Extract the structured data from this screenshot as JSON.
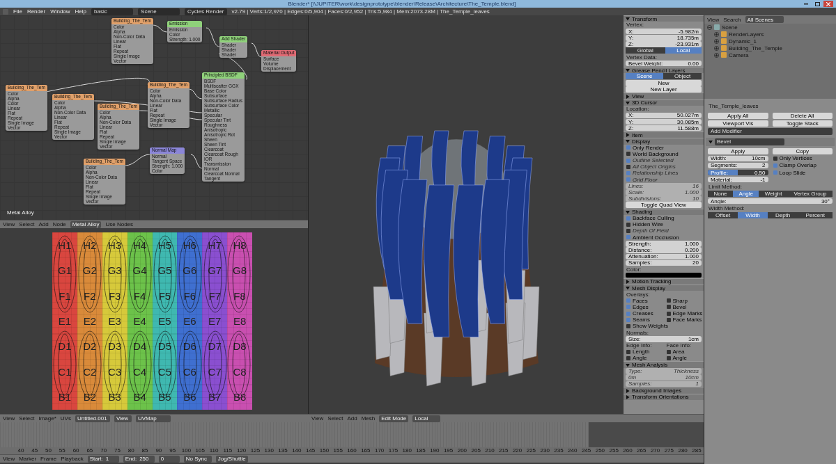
{
  "window": {
    "title": "Blender* [\\\\JUPITER\\work\\designprototype\\blender\\Release\\Architecture\\The_Temple.blend]"
  },
  "menu": {
    "items": [
      "File",
      "Render",
      "Window",
      "Help"
    ],
    "screen_layout": "basic",
    "scene": "Scene",
    "engine": "Cycles Render",
    "stats": "v2.79 | Verts:1/2,970 | Edges:0/5,904 | Faces:0/2,952 | Tris:5,984 | Mem:2073.28M | The_Temple_leaves"
  },
  "node_editor": {
    "material_label": "Metal Alloy",
    "nodes": [
      {
        "title": "Building_The_Tem",
        "kind": "image",
        "rows": [
          "Color",
          "Alpha",
          "Non-Color Data",
          "Linear",
          "Flat",
          "Repeat",
          "Single Image",
          "Vector"
        ]
      },
      {
        "title": "Emission",
        "kind": "shader",
        "rows": [
          "Emission",
          "Color",
          "Strength: 1.000"
        ]
      },
      {
        "title": "Add Shader",
        "kind": "shader",
        "rows": [
          "Shader",
          "Shader",
          "Shader"
        ]
      },
      {
        "title": "Material Output",
        "kind": "output",
        "rows": [
          "Surface",
          "Volume",
          "Displacement"
        ]
      },
      {
        "title": "Principled BSDF",
        "kind": "shader",
        "rows": [
          "BSDF",
          "Multiscatter GGX",
          "Base Color",
          "Subsurface",
          "Subsurface Radius",
          "Subsurface Color",
          "Metallic",
          "Specular",
          "Specular Tint",
          "Roughness",
          "Anisotropic",
          "Anisotropic Rot",
          "Sheen",
          "Sheen Tint",
          "Clearcoat",
          "Clearcoat Rough",
          "IOR",
          "Transmission",
          "Normal",
          "Clearcoat Normal",
          "Tangent"
        ]
      },
      {
        "title": "Building_The_Tem",
        "kind": "image",
        "rows": [
          "Color",
          "Alpha",
          "Color",
          "Linear",
          "Flat",
          "Repeat",
          "Single Image",
          "Vector"
        ]
      },
      {
        "title": "Building_The_Tem",
        "kind": "image",
        "rows": [
          "Color",
          "Alpha",
          "Non-Color Data",
          "Linear",
          "Flat",
          "Repeat",
          "Single Image",
          "Vector"
        ]
      },
      {
        "title": "Building_The_Tem",
        "kind": "image",
        "rows": [
          "Color",
          "Alpha",
          "Non-Color Data",
          "Linear",
          "Flat",
          "Repeat",
          "Single Image",
          "Vector"
        ]
      },
      {
        "title": "Building_The_Tem",
        "kind": "image",
        "rows": [
          "Color",
          "Alpha",
          "Non-Color Data",
          "Linear",
          "Flat",
          "Repeat",
          "Single Image",
          "Vector"
        ]
      },
      {
        "title": "Normal Map",
        "kind": "vector",
        "rows": [
          "Normal",
          "Tangent Space",
          "Strength: 1.000",
          "Color"
        ]
      },
      {
        "title": "Building_The_Tem",
        "kind": "image",
        "rows": [
          "Color",
          "Alpha",
          "Non-Color Data",
          "Linear",
          "Flat",
          "Repeat",
          "Single Image",
          "Vector"
        ]
      }
    ],
    "header": {
      "items": [
        "View",
        "Select",
        "Add",
        "Node"
      ],
      "material": "Metal Alloy",
      "use_nodes": "Use Nodes"
    }
  },
  "uv_editor": {
    "rows": [
      [
        "H1",
        "H2",
        "H3",
        "H4",
        "H5",
        "H6",
        "H7",
        "H8"
      ],
      [
        "G1",
        "G2",
        "G3",
        "G4",
        "G5",
        "G6",
        "G7",
        "G8"
      ],
      [
        "F1",
        "F2",
        "F3",
        "F4",
        "F5",
        "F6",
        "F7",
        "F8"
      ],
      [
        "E1",
        "E2",
        "E3",
        "E4",
        "E5",
        "E6",
        "E7",
        "E8"
      ],
      [
        "D1",
        "D2",
        "D3",
        "D4",
        "D5",
        "D6",
        "D7",
        "D8"
      ],
      [
        "C1",
        "C2",
        "C3",
        "C4",
        "C5",
        "C6",
        "C7",
        "C8"
      ],
      [
        "B1",
        "B2",
        "B3",
        "B4",
        "B5",
        "B6",
        "B7",
        "B8"
      ]
    ],
    "header": {
      "items": [
        "View",
        "Select",
        "Image*",
        "UVs"
      ],
      "image": "Untitled.001",
      "view": "View",
      "uv_map": "UVMap"
    }
  },
  "viewport_header": {
    "items": [
      "View",
      "Select",
      "Add",
      "Mesh"
    ],
    "mode": "Edit Mode",
    "orientation": "Local"
  },
  "n_panel": [
    {
      "kind": "header",
      "label": "Transform",
      "expanded": true
    },
    {
      "kind": "label",
      "label": "Vertex:"
    },
    {
      "kind": "field",
      "label": "X:",
      "value": "-5.982m"
    },
    {
      "kind": "field",
      "label": "Y:",
      "value": "18.735m"
    },
    {
      "kind": "field",
      "label": "Z:",
      "value": "-23.931m"
    },
    {
      "kind": "toggle",
      "options": [
        {
          "label": "Global",
          "selected": false
        },
        {
          "label": "Local",
          "selected": true
        }
      ]
    },
    {
      "kind": "label",
      "label": "Vertex Data:"
    },
    {
      "kind": "field",
      "label": "Bevel Weight:",
      "value": "0.00"
    },
    {
      "kind": "header",
      "label": "Grease Pencil Layers",
      "expanded": true
    },
    {
      "kind": "toggle",
      "options": [
        {
          "label": "Scene",
          "selected": true
        },
        {
          "label": "Object",
          "selected": false
        }
      ]
    },
    {
      "kind": "button",
      "label": "New"
    },
    {
      "kind": "button",
      "label": "New Layer"
    },
    {
      "kind": "header",
      "label": "View",
      "expanded": false
    },
    {
      "kind": "header",
      "label": "3D Cursor",
      "expanded": true
    },
    {
      "kind": "label",
      "label": "Location:"
    },
    {
      "kind": "field",
      "label": "X:",
      "value": "50.027m"
    },
    {
      "kind": "field",
      "label": "Y:",
      "value": "30.085m"
    },
    {
      "kind": "field",
      "label": "Z:",
      "value": "11.588m"
    },
    {
      "kind": "header",
      "label": "Item",
      "expanded": false
    },
    {
      "kind": "header",
      "label": "Display",
      "expanded": true
    },
    {
      "kind": "check",
      "label": "Only Render",
      "checked": true,
      "disabled": false
    },
    {
      "kind": "check",
      "label": "World Background",
      "checked": false,
      "disabled": false
    },
    {
      "kind": "check",
      "label": "Outline Selected",
      "checked": true,
      "disabled": true
    },
    {
      "kind": "check",
      "label": "All Object Origins",
      "checked": false,
      "disabled": true
    },
    {
      "kind": "check",
      "label": "Relationship Lines",
      "checked": true,
      "disabled": true
    },
    {
      "kind": "check",
      "label": "Grid Floor",
      "checked": true,
      "disabled": true
    },
    {
      "kind": "field",
      "label": "Lines:",
      "value": "16",
      "disabled": true
    },
    {
      "kind": "field",
      "label": "Scale:",
      "value": "1.000",
      "disabled": true
    },
    {
      "kind": "field",
      "label": "Subdivisions:",
      "value": "10",
      "disabled": true
    },
    {
      "kind": "button",
      "label": "Toggle Quad View"
    },
    {
      "kind": "header",
      "label": "Shading",
      "expanded": true
    },
    {
      "kind": "check",
      "label": "Backface Culling",
      "checked": true,
      "disabled": false
    },
    {
      "kind": "check",
      "label": "Hidden Wire",
      "checked": false,
      "disabled": false
    },
    {
      "kind": "check",
      "label": "Depth Of Field",
      "checked": false,
      "disabled": true
    },
    {
      "kind": "check",
      "label": "Ambient Occlusion",
      "checked": true,
      "disabled": false
    },
    {
      "kind": "field",
      "label": "Strength:",
      "value": "1.000"
    },
    {
      "kind": "field",
      "label": "Distance:",
      "value": "0.200"
    },
    {
      "kind": "field",
      "label": "Attenuation:",
      "value": "1.000"
    },
    {
      "kind": "field",
      "label": "Samples:",
      "value": "20"
    },
    {
      "kind": "label",
      "label": "Color:"
    },
    {
      "kind": "swatch"
    },
    {
      "kind": "header",
      "label": "Motion Tracking",
      "expanded": false
    },
    {
      "kind": "header",
      "label": "Mesh Display",
      "expanded": true
    },
    {
      "kind": "label",
      "label": "Overlays:"
    },
    {
      "kind": "checkpair",
      "items": [
        {
          "label": "Faces",
          "checked": true
        },
        {
          "label": "Sharp",
          "checked": false
        }
      ]
    },
    {
      "kind": "checkpair",
      "items": [
        {
          "label": "Edges",
          "checked": true
        },
        {
          "label": "Bevel",
          "checked": false
        }
      ]
    },
    {
      "kind": "checkpair",
      "items": [
        {
          "label": "Creases",
          "checked": true
        },
        {
          "label": "Edge Marks",
          "checked": false
        }
      ]
    },
    {
      "kind": "checkpair",
      "items": [
        {
          "label": "Seams",
          "checked": true
        },
        {
          "label": "Face Marks",
          "checked": false
        }
      ]
    },
    {
      "kind": "check",
      "label": "Show Weights",
      "checked": false,
      "disabled": false
    },
    {
      "kind": "label",
      "label": "Normals:"
    },
    {
      "kind": "field",
      "label": "Size:",
      "value": "1cm"
    },
    {
      "kind": "labelpair",
      "items": [
        "Edge Info:",
        "Face Info:"
      ]
    },
    {
      "kind": "checkpair",
      "items": [
        {
          "label": "Length",
          "checked": false
        },
        {
          "label": "Area",
          "checked": false
        }
      ]
    },
    {
      "kind": "checkpair",
      "items": [
        {
          "label": "Angle",
          "checked": false
        },
        {
          "label": "Angle",
          "checked": false
        }
      ]
    },
    {
      "kind": "header",
      "label": "Mesh Analysis",
      "expanded": true
    },
    {
      "kind": "field",
      "label": "Type:",
      "value": "Thickness",
      "disabled": true
    },
    {
      "kind": "field",
      "label": "0m",
      "value": "10cm",
      "disabled": true
    },
    {
      "kind": "field",
      "label": "Samples:",
      "value": "1",
      "disabled": true
    },
    {
      "kind": "header",
      "label": "Background Images",
      "expanded": false
    },
    {
      "kind": "header",
      "label": "Transform Orientations",
      "expanded": false
    }
  ],
  "outliner": {
    "view": "View",
    "search": "Search",
    "scenes": "All Scenes",
    "tree": [
      {
        "label": "Scene",
        "expanded": true,
        "children": [
          {
            "label": "RenderLayers",
            "expanded": false
          },
          {
            "label": "Dynamic_1",
            "expanded": false
          },
          {
            "label": "Building_The_Temple",
            "expanded": false
          },
          {
            "label": "Camera",
            "expanded": false
          }
        ]
      }
    ]
  },
  "properties": {
    "object": "The_Temple_leaves",
    "items": [
      {
        "kind": "buttonpair",
        "items": [
          "Apply All",
          "Delete All"
        ]
      },
      {
        "kind": "buttonpair",
        "items": [
          "Viewport Vis",
          "Toggle Stack"
        ]
      },
      {
        "kind": "dropdown",
        "label": "Add Modifier"
      },
      {
        "kind": "modifier",
        "label": "Bevel",
        "expanded": true
      },
      {
        "kind": "buttonpair",
        "items": [
          "Apply",
          "Copy"
        ]
      },
      {
        "kind": "fieldcheck",
        "label": "Width:",
        "value": "10cm",
        "check": {
          "label": "Only Vertices",
          "checked": false
        }
      },
      {
        "kind": "fieldcheck",
        "label": "Segments:",
        "value": "2",
        "check": {
          "label": "Clamp Overlap",
          "checked": true
        }
      },
      {
        "kind": "slidercheck",
        "label": "Profile:",
        "value": "0.50",
        "level": 0.5,
        "check": {
          "label": "Loop Slide",
          "checked": true
        }
      },
      {
        "kind": "fieldcheck",
        "label": "Material:",
        "value": "-1"
      },
      {
        "kind": "label",
        "label": "Limit Method:"
      },
      {
        "kind": "toggle",
        "options": [
          {
            "label": "None",
            "selected": false
          },
          {
            "label": "Angle",
            "selected": true
          },
          {
            "label": "Weight",
            "selected": false
          },
          {
            "label": "Vertex Group",
            "selected": false
          }
        ]
      },
      {
        "kind": "field",
        "label": "Angle:",
        "value": "30°"
      },
      {
        "kind": "label",
        "label": "Width Method:"
      },
      {
        "kind": "toggle",
        "options": [
          {
            "label": "Offset",
            "selected": false
          },
          {
            "label": "Width",
            "selected": true
          },
          {
            "label": "Depth",
            "selected": false
          },
          {
            "label": "Percent",
            "selected": false
          }
        ]
      }
    ]
  },
  "timeline": {
    "ticks": [
      "40",
      "45",
      "50",
      "55",
      "60",
      "65",
      "70",
      "75",
      "80",
      "85",
      "90",
      "95",
      "100",
      "105",
      "110",
      "115",
      "120",
      "125",
      "130",
      "135",
      "140",
      "145",
      "150",
      "155",
      "160",
      "165",
      "170",
      "175",
      "180",
      "185",
      "190",
      "195",
      "200",
      "205",
      "210",
      "215",
      "220",
      "225",
      "230",
      "235",
      "240",
      "245",
      "250",
      "255",
      "260",
      "265",
      "270",
      "275",
      "280",
      "285"
    ],
    "header": {
      "items": [
        "View",
        "Marker",
        "Frame",
        "Playback"
      ],
      "start": "Start:",
      "start_value": "1",
      "end": "End:",
      "end_value": "250",
      "current": "0",
      "sync": "No Sync",
      "keying": "Jog/Shuttle"
    }
  }
}
